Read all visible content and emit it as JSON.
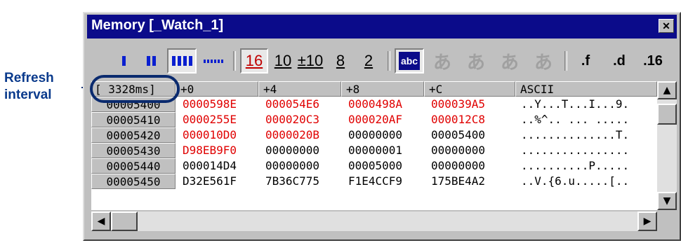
{
  "callout": {
    "line1": "Refresh",
    "line2": "interval"
  },
  "window": {
    "title": "Memory [_Watch_1]",
    "close_glyph": "✕"
  },
  "toolbar": {
    "radix": [
      "16",
      "10",
      "±10",
      "8",
      "2"
    ],
    "char_label": "abc",
    "kana": [
      "あ",
      "あ",
      "あ",
      "あ"
    ],
    "formats": [
      ".f",
      ".d",
      ".16"
    ]
  },
  "grid": {
    "refresh_interval": "[ 3328ms]",
    "columns": [
      "+0",
      "+4",
      "+8",
      "+C",
      "ASCII"
    ],
    "rows": [
      {
        "address": "00005400",
        "v0": "0000598E",
        "v4": "000054E6",
        "v8": "0000498A",
        "vc": "000039A5",
        "ascii": "..Y...T...I...9."
      },
      {
        "address": "00005410",
        "v0": "0000255E",
        "v4": "000020C3",
        "v8": "000020AF",
        "vc": "000012C8",
        "ascii": "..%^.. ... ....."
      },
      {
        "address": "00005420",
        "v0": "000010D0",
        "v4": "0000020B",
        "v8": "00000000",
        "vc": "00005400",
        "ascii": "..............T."
      },
      {
        "address": "00005430",
        "v0": "D98EB9F0",
        "v4": "00000000",
        "v8": "00000001",
        "vc": "00000000",
        "ascii": "................"
      },
      {
        "address": "00005440",
        "v0": "000014D4",
        "v4": "00000000",
        "v8": "00005000",
        "vc": "00000000",
        "ascii": "..........P....."
      },
      {
        "address": "00005450",
        "v0": "D32E561F",
        "v4": "7B36C775",
        "v8": "F1E4CCF9",
        "vc": "175BE4A2",
        "ascii": "..V.{6.u.....[.."
      }
    ]
  },
  "colors": {
    "title_bar": "#0b0b8a",
    "changed_value": "#e00000",
    "callout": "#0a3a8c"
  }
}
